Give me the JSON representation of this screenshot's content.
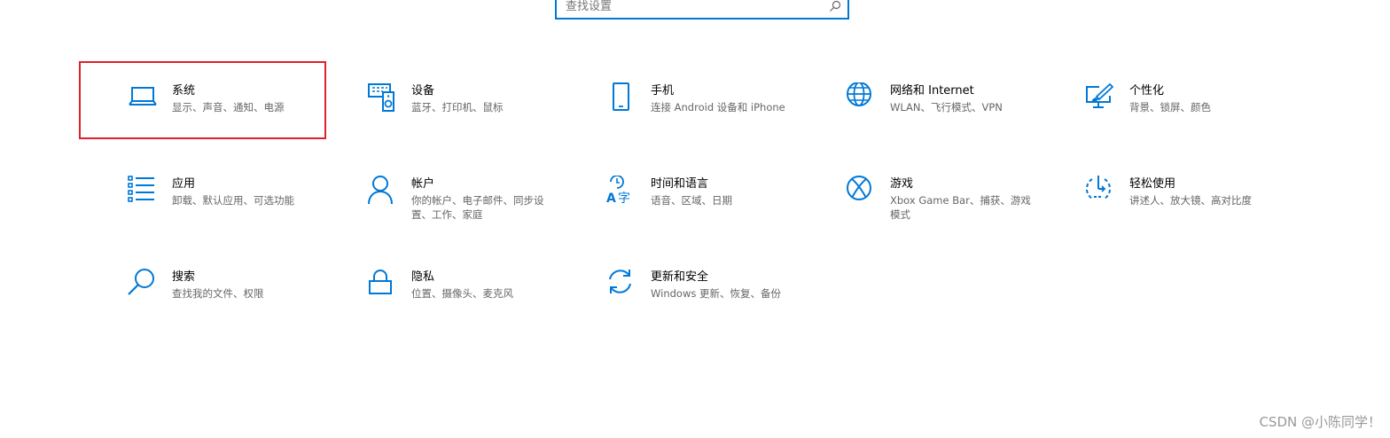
{
  "search": {
    "placeholder": "查找设置"
  },
  "accent_color": "#0078d7",
  "highlight_color": "#e0202c",
  "tiles": [
    {
      "icon": "laptop-icon",
      "title": "系统",
      "desc": "显示、声音、通知、电源"
    },
    {
      "icon": "devices-icon",
      "title": "设备",
      "desc": "蓝牙、打印机、鼠标"
    },
    {
      "icon": "phone-icon",
      "title": "手机",
      "desc": "连接 Android 设备和 iPhone"
    },
    {
      "icon": "globe-icon",
      "title": "网络和 Internet",
      "desc": "WLAN、飞行模式、VPN"
    },
    {
      "icon": "personalization-icon",
      "title": "个性化",
      "desc": "背景、锁屏、颜色"
    },
    {
      "icon": "apps-list-icon",
      "title": "应用",
      "desc": "卸载、默认应用、可选功能"
    },
    {
      "icon": "person-icon",
      "title": "帐户",
      "desc": "你的帐户、电子邮件、同步设置、工作、家庭"
    },
    {
      "icon": "time-language-icon",
      "title": "时间和语言",
      "desc": "语音、区域、日期"
    },
    {
      "icon": "xbox-icon",
      "title": "游戏",
      "desc": "Xbox Game Bar、捕获、游戏模式"
    },
    {
      "icon": "ease-of-access-icon",
      "title": "轻松使用",
      "desc": "讲述人、放大镜、高对比度"
    },
    {
      "icon": "search-icon",
      "title": "搜索",
      "desc": "查找我的文件、权限"
    },
    {
      "icon": "lock-icon",
      "title": "隐私",
      "desc": "位置、摄像头、麦克风"
    },
    {
      "icon": "update-sync-icon",
      "title": "更新和安全",
      "desc": "Windows 更新、恢复、备份"
    }
  ],
  "watermark": "CSDN @小陈同学！"
}
